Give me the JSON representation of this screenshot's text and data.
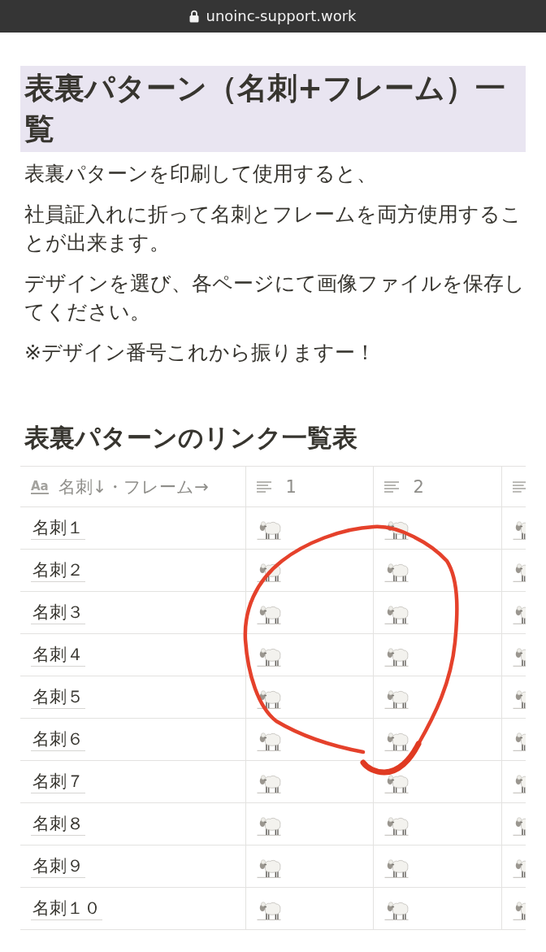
{
  "address_bar": {
    "url": "unoinc-support.work"
  },
  "title": "表裏パターン（名刺+フレーム）一覧",
  "paragraphs": [
    "表裏パターンを印刷して使用すると、",
    "社員証入れに折って名刺とフレームを両方使用することが出来ます。",
    "デザインを選び、各ページにて画像ファイルを保存してください。",
    "※デザイン番号これから振りますー！"
  ],
  "section_heading": "表裏パターンのリンク一覧表",
  "table": {
    "columns": [
      {
        "kind": "title",
        "type_icon": "Aa",
        "label": "名刺↓・フレーム→",
        "cut_off": false
      },
      {
        "kind": "text",
        "label": "1",
        "cut_off": false
      },
      {
        "kind": "text",
        "label": "2",
        "cut_off": false
      },
      {
        "kind": "text",
        "cut_off": true
      }
    ],
    "rows": [
      "名刺１",
      "名刺２",
      "名刺３",
      "名刺４",
      "名刺５",
      "名刺６",
      "名刺７",
      "名刺８",
      "名刺９",
      "名刺１０"
    ]
  }
}
